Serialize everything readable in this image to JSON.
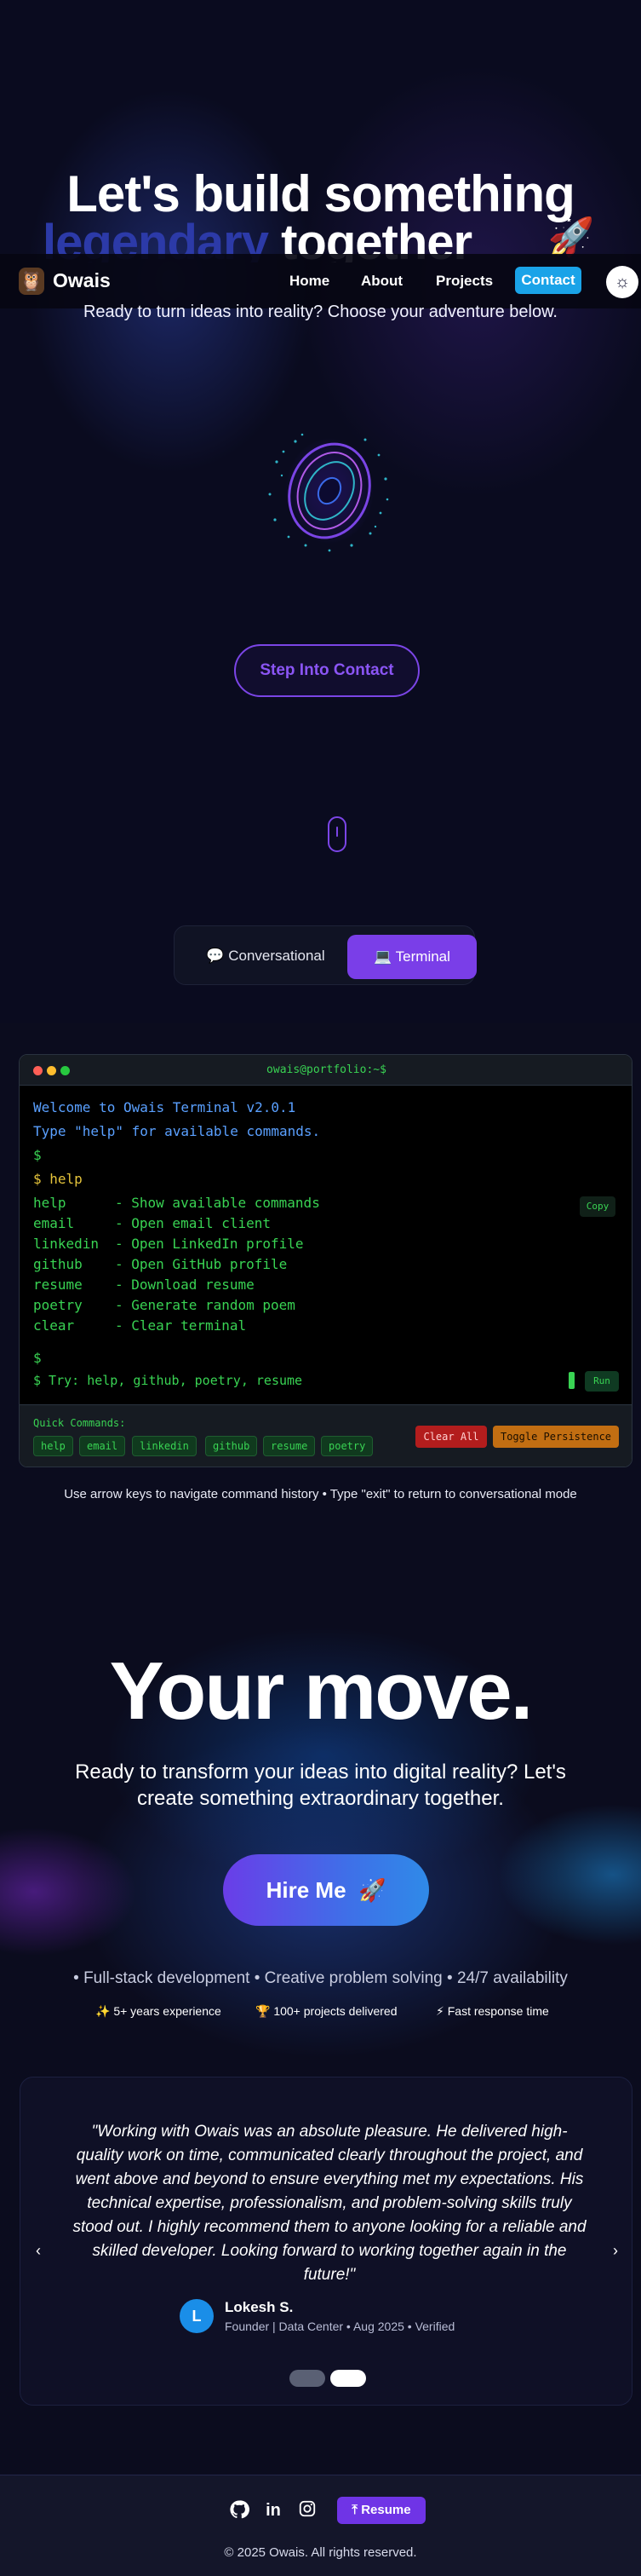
{
  "hero": {
    "title_line1": "Let's build something",
    "title_line2_accent": "legendary",
    "title_line2_rest": " together",
    "title_badge_icon": "rocket-icon",
    "subtitle": "Ready to turn ideas into reality? Choose your adventure below.",
    "step_contact_label": "Step Into Contact",
    "portal_icon": "portal-icon",
    "scroll_icon": "mouse-scroll-icon"
  },
  "navbar": {
    "logo_icon": "owl-icon",
    "logo_text": "Owais",
    "links": [
      "Home",
      "About",
      "Projects"
    ],
    "contact_label": "Contact",
    "theme_icon": "sun-icon"
  },
  "mode_switch": {
    "conversational_icon": "speech-bubble-icon",
    "conversational_label": "Conversational",
    "terminal_icon": "laptop-icon",
    "terminal_label": "Terminal",
    "active": "Terminal"
  },
  "terminal": {
    "title": "owais@portfolio:~$",
    "welcome": "Welcome to Owais Terminal v2.0.1",
    "hint": "Type \"help\" for available commands.",
    "prompt": "$",
    "command": "$ help",
    "commands": [
      {
        "name": "help",
        "desc": "- Show available commands"
      },
      {
        "name": "email",
        "desc": "- Open email client"
      },
      {
        "name": "linkedin",
        "desc": "- Open LinkedIn profile"
      },
      {
        "name": "github",
        "desc": "- Open GitHub profile"
      },
      {
        "name": "resume",
        "desc": "- Download resume"
      },
      {
        "name": "poetry",
        "desc": "- Generate random poem"
      },
      {
        "name": "clear",
        "desc": "- Clear terminal"
      }
    ],
    "copy_label": "Copy",
    "input_placeholder": "$ Try: help, github, poetry, resume",
    "run_label": "Run",
    "quick_label": "Quick Commands:",
    "quick_commands": [
      "help",
      "email",
      "linkedin",
      "github",
      "resume",
      "poetry"
    ],
    "clear_all_label": "Clear All",
    "toggle_persistence_label": "Toggle Persistence",
    "colors": {
      "green": "#39d353",
      "blue": "#5aa0ff",
      "yellow": "#e5c43b"
    }
  },
  "terminal_hint": "Use arrow keys to navigate command history • Type \"exit\" to return to conversational mode",
  "cta": {
    "title": "Your move.",
    "subtitle": "Ready to transform your ideas into digital reality? Let's create something extraordinary together.",
    "hire_label": "Hire Me",
    "hire_icon": "rocket-icon",
    "skills": "• Full-stack development • Creative problem solving • 24/7 availability",
    "stats": [
      {
        "icon": "sparkles-icon",
        "label": "5+ years experience"
      },
      {
        "icon": "trophy-icon",
        "label": "100+ projects delivered"
      },
      {
        "icon": "lightning-icon",
        "label": "Fast response time"
      }
    ]
  },
  "testimonial": {
    "quote": "\"Working with Owais was an absolute pleasure. He delivered high-quality work on time, communicated clearly throughout the project, and went above and beyond to ensure everything met my expectations. His technical expertise, professionalism, and problem-solving skills truly stood out. I highly recommend them to anyone looking for a reliable and skilled developer. Looking forward to working together again in the future!\"",
    "avatar_initial": "L",
    "author": "Lokesh S.",
    "meta": "Founder | Data Center • Aug 2025 • Verified",
    "prev_icon": "chevron-left-icon",
    "next_icon": "chevron-right-icon",
    "active_slide": 2,
    "total_slides": 2
  },
  "footer": {
    "icons": [
      "github-icon",
      "linkedin-icon",
      "instagram-icon"
    ],
    "resume_label": "Resume",
    "resume_icon": "upload-icon",
    "copyright": "© 2025 Owais. All rights reserved."
  }
}
